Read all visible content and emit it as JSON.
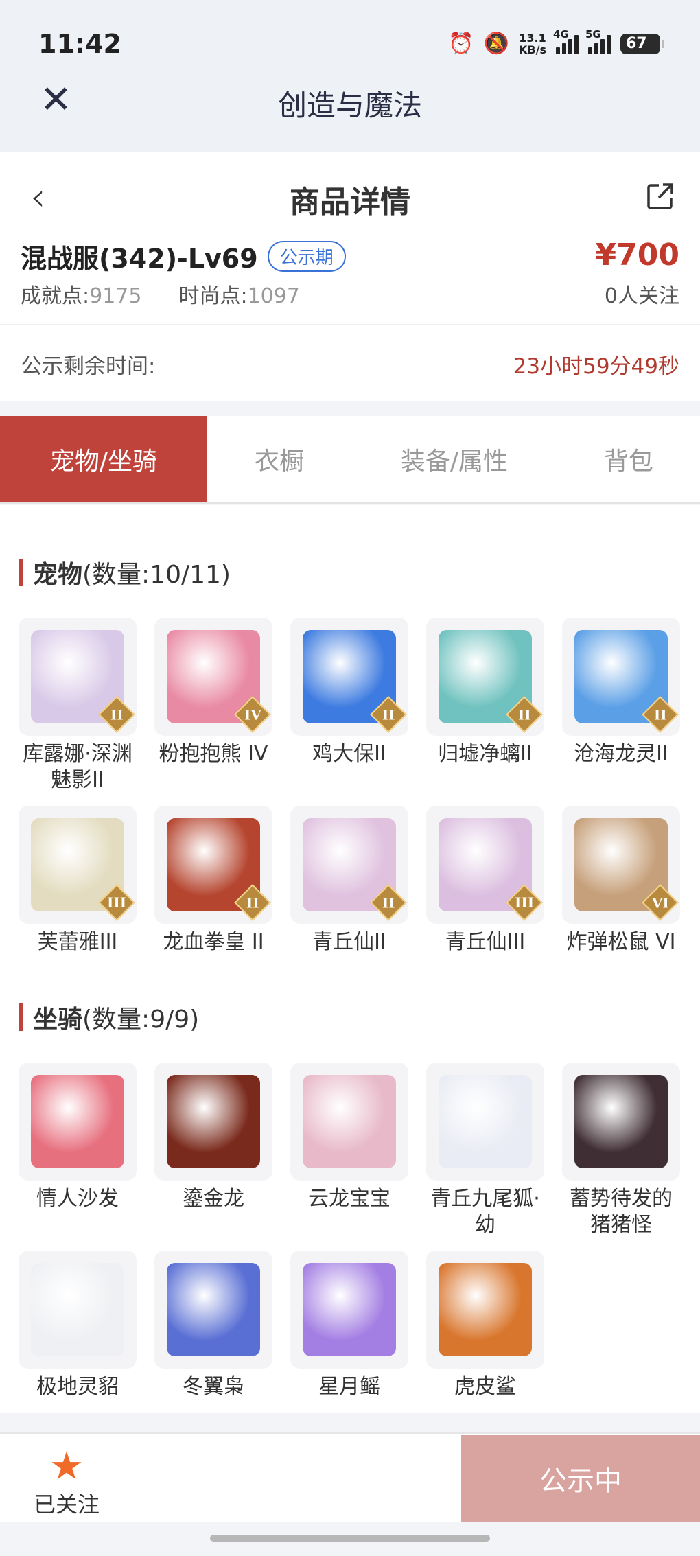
{
  "status_bar": {
    "time": "11:42",
    "net_speed_value": "13.1",
    "net_speed_unit": "KB/s",
    "sim1": "4G",
    "sim2": "5G",
    "battery": "67"
  },
  "app_bar": {
    "title": "创造与魔法",
    "close_icon": "close-icon"
  },
  "header": {
    "title": "商品详情",
    "back_icon": "chevron-left-icon",
    "share_icon": "share-icon"
  },
  "item": {
    "name": "混战服(342)-Lv69",
    "status_badge": "公示期",
    "price": "¥700",
    "followers": "0人关注",
    "achievement_label": "成就点:",
    "achievement_value": "9175",
    "fashion_label": "时尚点:",
    "fashion_value": "1097"
  },
  "timer": {
    "label": "公示剩余时间:",
    "value": "23小时59分49秒"
  },
  "tabs": [
    {
      "label": "宠物/坐骑",
      "active": true
    },
    {
      "label": "衣橱",
      "active": false
    },
    {
      "label": "装备/属性",
      "active": false
    },
    {
      "label": "背包",
      "active": false
    }
  ],
  "pets": {
    "title": "宠物",
    "count": "(数量:10/11)",
    "items": [
      {
        "name": "库露娜·深渊魅影II",
        "grade": "II",
        "color": "#d9c9e8"
      },
      {
        "name": "粉抱抱熊 IV",
        "grade": "IV",
        "color": "#e98aa4"
      },
      {
        "name": "鸡大保II",
        "grade": "II",
        "color": "#3d7be0"
      },
      {
        "name": "归墟净螭II",
        "grade": "II",
        "color": "#6fc2bf"
      },
      {
        "name": "沧海龙灵II",
        "grade": "II",
        "color": "#5b9fe6"
      },
      {
        "name": "芙蕾雅III",
        "grade": "III",
        "color": "#e3dcc0"
      },
      {
        "name": "龙血拳皇 II",
        "grade": "II",
        "color": "#b5452f"
      },
      {
        "name": "青丘仙II",
        "grade": "II",
        "color": "#e0c2df"
      },
      {
        "name": "青丘仙III",
        "grade": "III",
        "color": "#dcbfe0"
      },
      {
        "name": "炸弹松鼠 VI",
        "grade": "VI",
        "color": "#c6a07a"
      }
    ]
  },
  "mounts": {
    "title": "坐骑",
    "count": "(数量:9/9)",
    "items": [
      {
        "name": "情人沙发",
        "color": "#e7707f"
      },
      {
        "name": "鎏金龙",
        "color": "#7a2a1c"
      },
      {
        "name": "云龙宝宝",
        "color": "#e8b9c8"
      },
      {
        "name": "青丘九尾狐·幼",
        "color": "#e9ecf4"
      },
      {
        "name": "蓄势待发的猪猪怪",
        "color": "#3f2e33"
      },
      {
        "name": "极地灵貂",
        "color": "#eef0f3"
      },
      {
        "name": "冬翼枭",
        "color": "#5a6fd4"
      },
      {
        "name": "星月鳐",
        "color": "#a47fe3"
      },
      {
        "name": "虎皮鲨",
        "color": "#d9762e"
      }
    ]
  },
  "bottom_bar": {
    "follow_label": "已关注",
    "follow_icon": "star-icon",
    "cta_label": "公示中",
    "accent": "#c0433b"
  }
}
